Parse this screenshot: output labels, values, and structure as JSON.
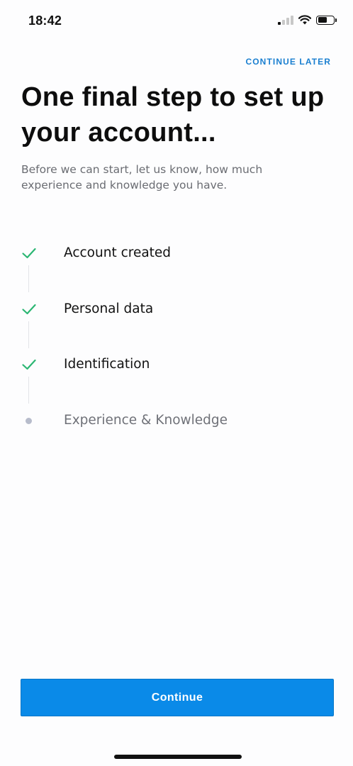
{
  "status_bar": {
    "time": "18:42",
    "icons": [
      "cellular-signal-icon",
      "wifi-icon",
      "battery-icon"
    ],
    "signal_bars_active": 1,
    "signal_bars_total": 4,
    "battery_level": 0.6
  },
  "header": {
    "continue_later_label": "CONTINUE LATER"
  },
  "main": {
    "title": "One final step to set up your account...",
    "subtitle": "Before we can start, let us know, how much experience and knowledge you have."
  },
  "steps": [
    {
      "label": "Account created",
      "status": "done",
      "icon": "checkmark-icon"
    },
    {
      "label": "Personal data",
      "status": "done",
      "icon": "checkmark-icon"
    },
    {
      "label": "Identification",
      "status": "done",
      "icon": "checkmark-icon"
    },
    {
      "label": "Experience & Knowledge",
      "status": "pending",
      "icon": "pending-dot-icon"
    }
  ],
  "footer": {
    "continue_label": "Continue"
  },
  "colors": {
    "accent": "#0a8ae8",
    "link": "#1a7fd0",
    "check": "#2bb673",
    "pending_dot": "#b7bccb"
  }
}
